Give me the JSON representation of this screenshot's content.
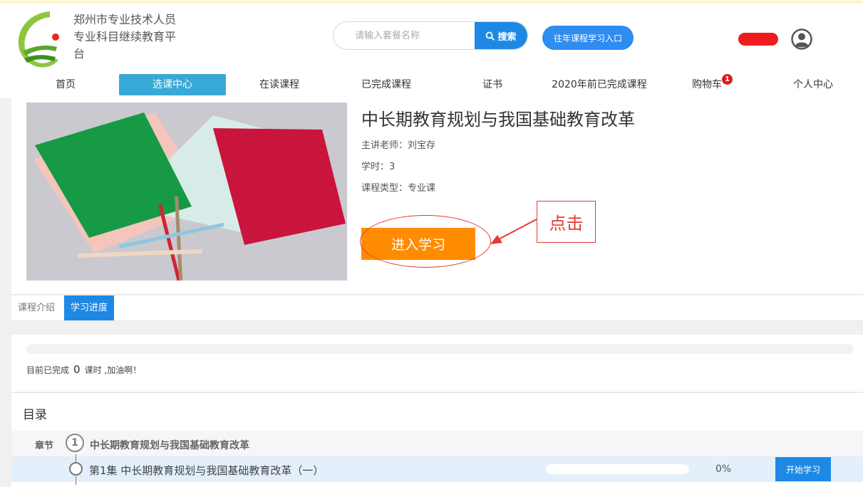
{
  "site": {
    "title": "郑州市专业技术人员专业科目继续教育平台"
  },
  "search": {
    "placeholder": "请输入套餐名称",
    "button_label": "搜索",
    "button_icon": "search-icon"
  },
  "header": {
    "past_courses_label": "往年课程学习入口",
    "user_icon": "user-avatar-icon"
  },
  "nav": {
    "items": [
      {
        "label": "首页"
      },
      {
        "label": "选课中心",
        "active": true
      },
      {
        "label": "在读课程"
      },
      {
        "label": "已完成课程"
      },
      {
        "label": "证书"
      },
      {
        "label": "2020年前已完成课程"
      },
      {
        "label": "购物车",
        "badge": "1"
      },
      {
        "label": "个人中心"
      }
    ]
  },
  "course": {
    "title": "中长期教育规划与我国基础教育改革",
    "teacher_line": "主讲老师：刘宝存",
    "hours_line": "学时：3",
    "type_line": "课程类型：专业课",
    "enter_button": "进入学习"
  },
  "annotation": {
    "callout_text": "点击",
    "color": "#e53935"
  },
  "tabs": [
    {
      "label": "课程介绍",
      "active": false
    },
    {
      "label": "学习进度",
      "active": true
    }
  ],
  "progress": {
    "prefix": "目前已完成",
    "completed_hours": "0",
    "suffix": "课时 ,加油啊！",
    "fraction": 0
  },
  "catalog": {
    "heading": "目录",
    "chapter": {
      "label": "章节",
      "number": "1",
      "title": "中长期教育规划与我国基础教育改革"
    },
    "lessons": [
      {
        "title": "第1集 中长期教育规划与我国基础教育改革（一）",
        "progress_percent": "0%",
        "progress_fraction": 0,
        "button_label": "开始学习"
      }
    ]
  },
  "colors": {
    "primary_blue": "#1e88e5",
    "nav_active": "#38a9d6",
    "enter_orange": "#ff8c00",
    "badge_red": "#e21919"
  }
}
